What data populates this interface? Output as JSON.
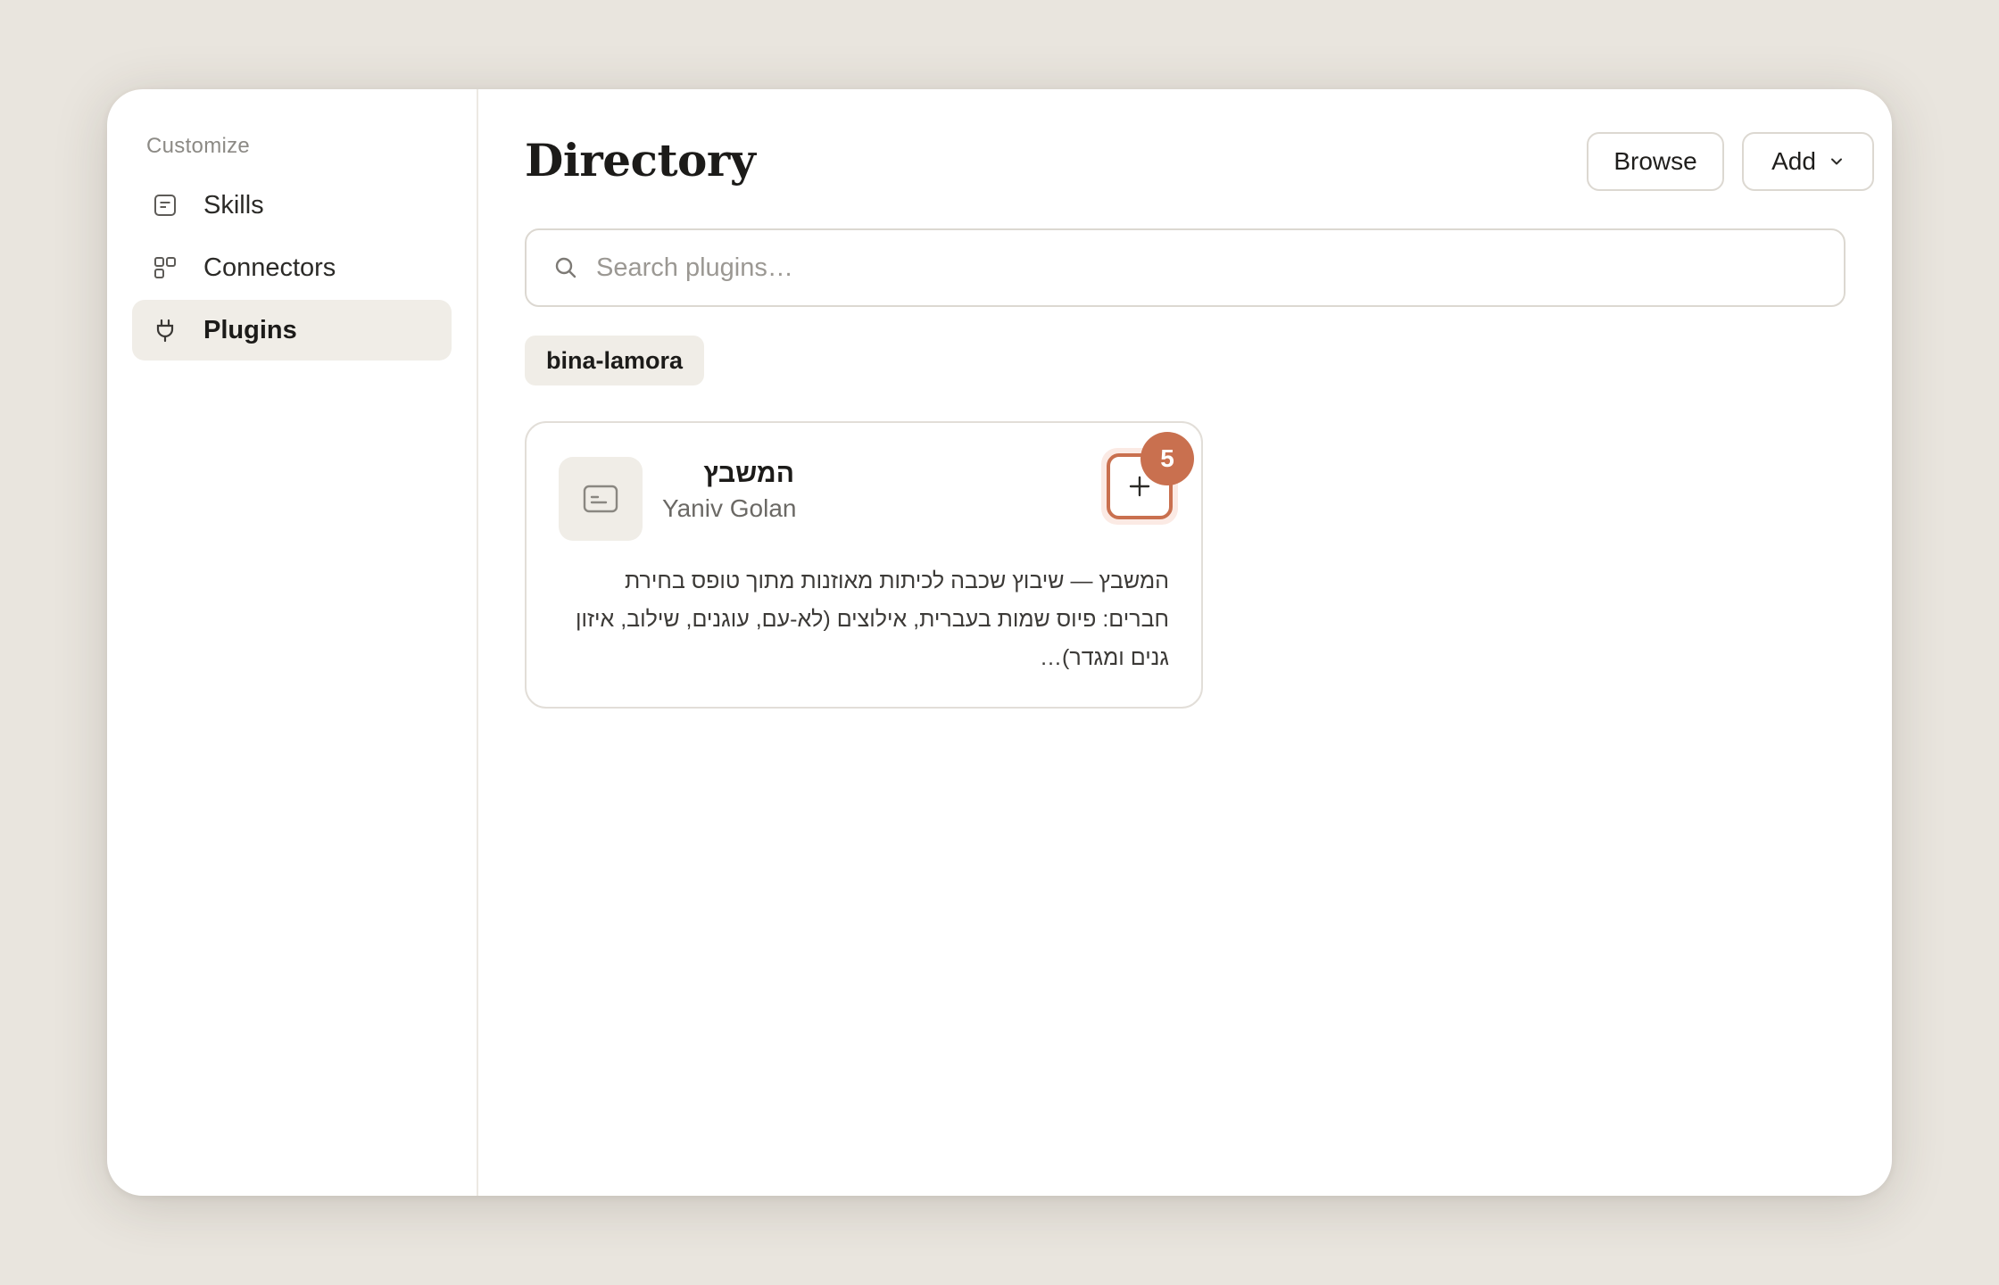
{
  "sidebar": {
    "heading": "Customize",
    "items": [
      {
        "label": "Skills",
        "icon": "skills-icon"
      },
      {
        "label": "Connectors",
        "icon": "connectors-icon"
      },
      {
        "label": "Plugins",
        "icon": "plug-icon",
        "active": true
      }
    ]
  },
  "header": {
    "title": "Directory",
    "browse_label": "Browse",
    "add_label": "Add"
  },
  "search": {
    "placeholder": "Search plugins…",
    "value": ""
  },
  "filter_chip": "bina-lamora",
  "plugins": [
    {
      "name": "המשבץ",
      "author": "Yaniv Golan",
      "description": "המשבץ — שיבוץ שכבה לכיתות מאוזנות מתוך טופס בחירת חברים: פיוס שמות בעברית, אילוצים (לא-עם, עוגנים, שילוב, איזון גנים ומגדר)…",
      "badge": "5",
      "icon": "plugin-card-icon"
    }
  ],
  "colors": {
    "accent": "#c9704f",
    "background": "#e9e5de",
    "active_item": "#f0ede7"
  }
}
